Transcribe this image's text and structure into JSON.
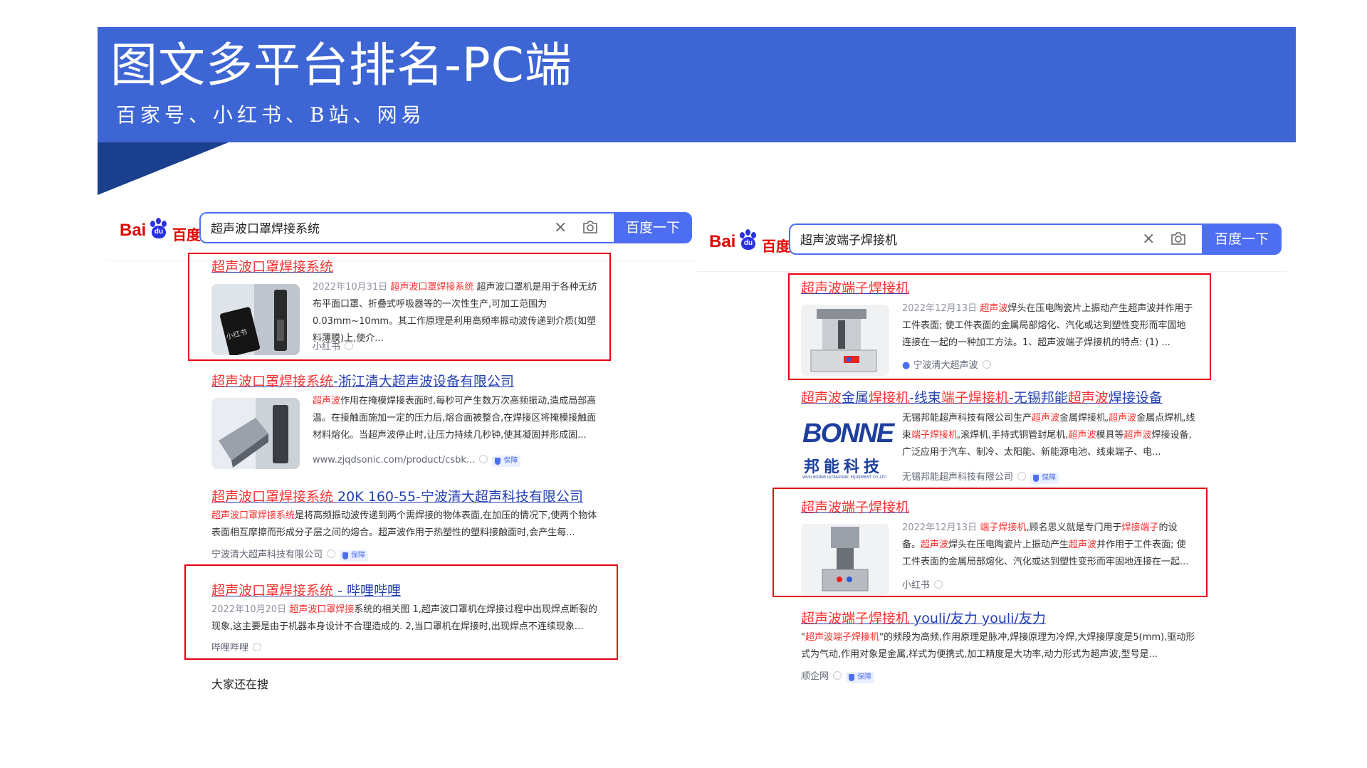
{
  "slide": {
    "title": "图文多平台排名-PC端",
    "subtitle": "百家号、小红书、B站、网易",
    "colors": {
      "banner": "#3d65d4",
      "fold": "#1a3f8c"
    }
  },
  "baidu": {
    "logo_latin": "Bai",
    "logo_du": "du",
    "logo_cn": "百度",
    "button_label": "百度一下",
    "colors": {
      "button": "#4e6ef2",
      "link": "#2440b3",
      "highlight": "#f73131",
      "box": "#e60012"
    }
  },
  "left": {
    "query": "超声波口罩焊接系统",
    "results": [
      {
        "title_hl": "超声波口罩焊接系统",
        "title_rest": "",
        "date": "2022年10月31日",
        "hl": "超声波口罩焊接系统",
        "text": " 超声波口罩机是用于各种无纺布平面口罩、折叠式呼吸器等的一次性生产,可加工范围为0.03mm~10mm。其工作原理是利用高频率振动波传递到介质(如塑料薄膜)上,使介...",
        "source": "小红书",
        "thumb_label": "小红书"
      },
      {
        "title_hl": "超声波口罩焊接系统",
        "title_rest": "-浙江清大超声波设备有限公司",
        "hl": "超声波",
        "text": "作用在掩模焊接表面时,每秒可产生数万次高频振动,造成局部高温。在接触面施加一定的压力后,熔合面被整合,在焊接区将掩模接触面材料熔化。当超声波停止时,让压力持续几秒钟,使其凝固并形成固...",
        "source": "www.zjqdsonic.com/product/csbk...",
        "badge": "保障"
      },
      {
        "title_hl": "超声波口罩焊接系统",
        "title_rest": " 20K 160-55-宁波清大超声科技有限公司",
        "hl": "超声波口罩焊接系统",
        "text": "是将高频振动波传递到两个需焊接的物体表面,在加压的情况下,使两个物体表面相互摩擦而形成分子层之间的熔合。超声波作用于热塑性的塑料接触面时,会产生每...",
        "source": "宁波清大超声科技有限公司",
        "badge": "保障"
      },
      {
        "title_hl": "超声波口罩焊接系统",
        "title_rest": " - 哔哩哔哩",
        "date": "2022年10月20日",
        "hl": "超声波口罩焊接",
        "text": "系统的相关图 1,超声波口罩机在焊接过程中出现焊点断裂的现象,这主要是由于机器本身设计不合理造成的. 2,当口罩机在焊接时,出现焊点不连续现象...",
        "source": "哔哩哔哩"
      }
    ],
    "also": "大家还在搜"
  },
  "right": {
    "query": "超声波端子焊接机",
    "results": [
      {
        "title_hl": "超声波端子焊接机",
        "title_rest": "",
        "date": "2022年12月13日",
        "hl": "超声波",
        "text": "焊头在压电陶瓷片上振动产生超声波并作用于工件表面; 使工件表面的金属局部熔化、汽化或达到塑性变形而牢固地连接在一起的一种加工方法。1、超声波端子焊接机的特点: (1) ...",
        "source": "宁波清大超声波"
      },
      {
        "title_parts": [
          "超声波",
          "金属",
          "焊接机",
          "-线束",
          "端子焊接机",
          "-无锡邦能",
          "超声波",
          "焊接设备"
        ],
        "text_parts": [
          "无锡邦能超声科技有限公司生产",
          "超声波",
          "金属焊接机,",
          "超声波",
          "金属点焊机,线束",
          "端子焊接机",
          ",滚焊机,手持式铜管封尾机,",
          "超声波",
          "模具等",
          "超声波",
          "焊接设备,广泛应用于汽车、制冷、太阳能、新能源电池、线束端子、电..."
        ],
        "source": "无锡邦能超声科技有限公司",
        "badge": "保障",
        "logo_text": "BONNE",
        "logo_cn": "邦能科技",
        "logo_small": "WUXI BONNE ULTRASONIC EQUIPMENT CO.,LTD"
      },
      {
        "title_hl": "超声波端子焊接机",
        "title_rest": "",
        "date": "2022年12月13日",
        "hl": "端子焊接机",
        "text_parts": [
          ",顾名思义就是专门用于",
          "焊接端子",
          "的设备。",
          "超声波",
          "焊头在压电陶瓷片上振动产生",
          "超声波",
          "并作用于工件表面; 使工件表面的金属局部熔化、汽化或达到塑性变形而牢固地连接在一起..."
        ],
        "source": "小红书"
      },
      {
        "title_hl": "超声波端子焊接机",
        "title_rest": " youli/友力 youli/友力",
        "text_parts": [
          "\"",
          "超声波端子焊接机",
          "\"的频段为高频,作用原理是脉冲,焊接原理为冷焊,大焊接厚度是5(mm),驱动形式为气动,作用对象是金属,样式为便携式,加工精度是大功率,动力形式为超声波,型号是..."
        ],
        "source": "顺企网",
        "badge": "保障"
      }
    ]
  }
}
